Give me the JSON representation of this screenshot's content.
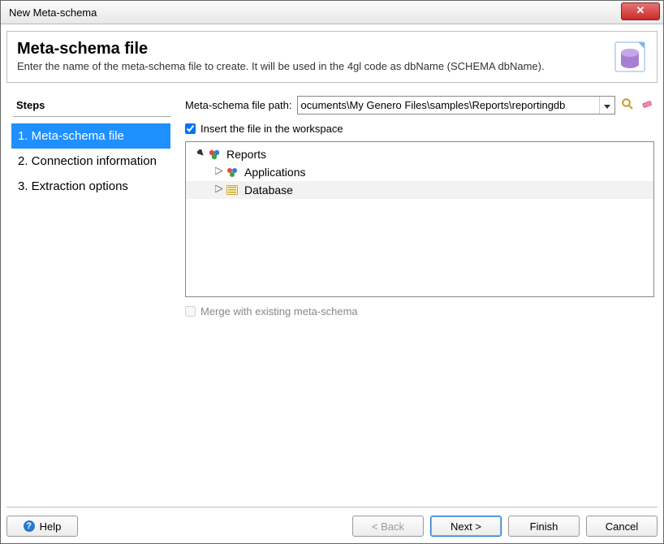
{
  "window_title": "New Meta-schema",
  "header": {
    "title": "Meta-schema file",
    "description": "Enter the name of the meta-schema file to create. It will be used in the 4gl code as dbName (SCHEMA dbName)."
  },
  "steps": {
    "heading": "Steps",
    "items": [
      {
        "label": "1. Meta-schema file",
        "active": true
      },
      {
        "label": "2. Connection information",
        "active": false
      },
      {
        "label": "3. Extraction options",
        "active": false
      }
    ]
  },
  "content": {
    "path_label": "Meta-schema file path:",
    "path_value": "ocuments\\My Genero Files\\samples\\Reports\\reportingdb",
    "insert_checkbox_label": "Insert the file in the workspace",
    "insert_checkbox_checked": true,
    "tree": {
      "root": "Reports",
      "children": [
        {
          "label": "Applications",
          "selected": false
        },
        {
          "label": "Database",
          "selected": true
        }
      ]
    },
    "merge_checkbox_label": "Merge with existing meta-schema",
    "merge_checkbox_checked": false,
    "merge_checkbox_enabled": false
  },
  "buttons": {
    "help": "Help",
    "back": "< Back",
    "next": "Next >",
    "finish": "Finish",
    "cancel": "Cancel"
  }
}
